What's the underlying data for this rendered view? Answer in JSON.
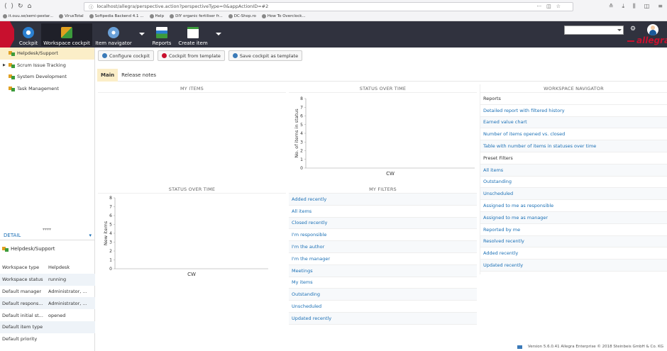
{
  "browser": {
    "url": "localhost/allegra/perspective.action?perspectiveType=0&appActionID=#2",
    "bookmarks": [
      "it.ouu.se/semi-pestar...",
      "VirusTotal",
      "Softpedia Backend 4.1 ...",
      "Help",
      "DIY organic fertiliser fr...",
      "DC-Shop.ro",
      "How To Overclock..."
    ]
  },
  "header": {
    "items": [
      {
        "label": "Cockpit",
        "icon": "compass-icon"
      },
      {
        "label": "Workspace cockpit",
        "icon": "puzzle-icon"
      },
      {
        "label": "Item navigator",
        "icon": "navigator-icon"
      },
      {
        "label": "Reports",
        "icon": "reports-icon"
      },
      {
        "label": "Create item",
        "icon": "clipboard-icon"
      }
    ],
    "logo": "allegra",
    "colors": {
      "bar": "#30323e",
      "accent": "#c8102e"
    }
  },
  "tree": {
    "items": [
      {
        "label": "Helpdesk/Support",
        "selected": true
      },
      {
        "label": "Scrum Issue Tracking",
        "expandable": true
      },
      {
        "label": "System Development"
      },
      {
        "label": "Task Management"
      }
    ]
  },
  "detail": {
    "header": "DETAIL",
    "title": "Helpdesk/Support",
    "rows": [
      {
        "key": "Workspace type",
        "value": "Helpdesk"
      },
      {
        "key": "Workspace status",
        "value": "running"
      },
      {
        "key": "Default manager",
        "value": "Administrator, ..."
      },
      {
        "key": "Default respons...",
        "value": "Administrator, ..."
      },
      {
        "key": "Default initial st...",
        "value": "opened"
      },
      {
        "key": "Default item type",
        "value": ""
      },
      {
        "key": "Default priority",
        "value": ""
      }
    ]
  },
  "toolbar": {
    "configure": "Configure cockpit",
    "from_template": "Cockpit from template",
    "save_template": "Save cockpit as template"
  },
  "tabs": [
    "Main",
    "Release notes"
  ],
  "panels": {
    "my_items": "MY ITEMS",
    "status1": "STATUS OVER TIME",
    "status2": "STATUS OVER TIME",
    "my_filters": "MY FILTERS",
    "workspace_nav": "WORKSPACE NAVIGATOR"
  },
  "chart_data": [
    {
      "type": "line",
      "title": "STATUS OVER TIME",
      "ylabel": "No. of items in status",
      "xlabel": "",
      "categories": [
        "CW"
      ],
      "yticks": [
        0,
        1,
        2,
        3,
        4,
        5,
        6,
        7,
        8
      ],
      "ylim": [
        0,
        8
      ],
      "series": []
    },
    {
      "type": "line",
      "title": "STATUS OVER TIME",
      "ylabel": "New items",
      "xlabel": "",
      "categories": [
        "CW"
      ],
      "yticks": [
        0,
        1,
        2,
        3,
        4,
        5,
        6,
        7,
        8
      ],
      "ylim": [
        0,
        8
      ],
      "series": []
    }
  ],
  "my_filters": [
    "Added recently",
    "All items",
    "Closed recently",
    "I'm responsible",
    "I'm the author",
    "I'm the manager",
    "Meetings",
    "My items",
    "Outstanding",
    "Unscheduled",
    "Updated recently"
  ],
  "navigator": {
    "reports_header": "Reports",
    "reports": [
      "Detailed report with filtered history",
      "Earned value chart",
      "Number of items opened vs. closed",
      "Table with number of items in statuses over time"
    ],
    "filters_header": "Preset Filters",
    "filters": [
      "All items",
      "Outstanding",
      "Unscheduled",
      "Assigned to me as responsible",
      "Assigned to me as manager",
      "Reported by me",
      "Resolved recently",
      "Added recently",
      "Updated recently"
    ]
  },
  "footer": "Version 5.6.0.41 Allegra Enterprise  © 2018 Steinbeis GmbH & Co. KG"
}
